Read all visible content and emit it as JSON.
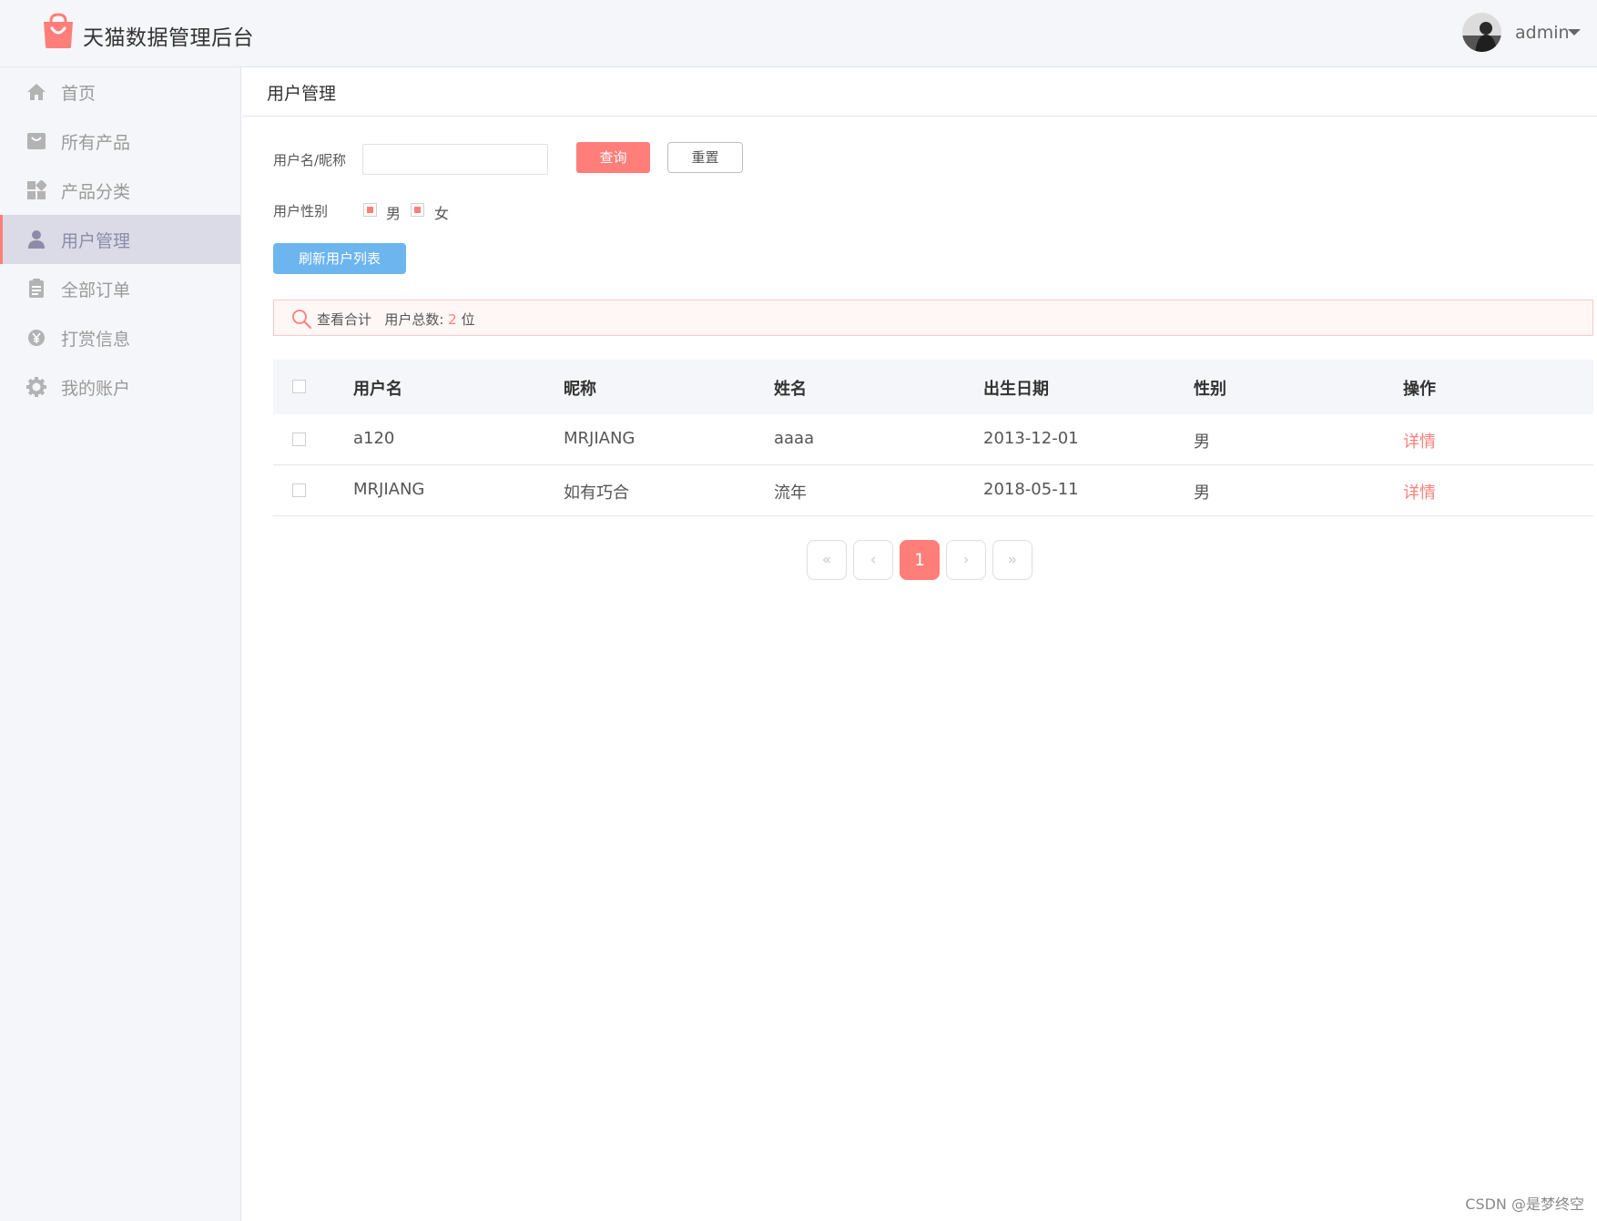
{
  "header": {
    "app_title": "天猫数据管理后台",
    "username": "admin",
    "logo_icon": "shopping-bag-icon",
    "avatar_icon": "user-avatar"
  },
  "sidebar": {
    "items": [
      {
        "label": "首页",
        "icon": "home-icon"
      },
      {
        "label": "所有产品",
        "icon": "product-icon"
      },
      {
        "label": "产品分类",
        "icon": "category-icon"
      },
      {
        "label": "用户管理",
        "icon": "user-icon",
        "active": true
      },
      {
        "label": "全部订单",
        "icon": "order-icon"
      },
      {
        "label": "打赏信息",
        "icon": "yen-coin-icon"
      },
      {
        "label": "我的账户",
        "icon": "gear-icon"
      }
    ]
  },
  "page": {
    "title": "用户管理",
    "filters": {
      "name_label": "用户名/昵称",
      "name_value": "",
      "name_placeholder": "",
      "query_button": "查询",
      "reset_button": "重置",
      "gender_label": "用户性别",
      "gender_options": [
        "男",
        "女"
      ]
    },
    "refresh_button": "刷新用户列表",
    "summary": {
      "prefix": "查看合计",
      "count_label": "用户总数:",
      "count": "2",
      "unit": "位"
    },
    "table": {
      "columns": [
        "用户名",
        "昵称",
        "姓名",
        "出生日期",
        "性别",
        "操作"
      ],
      "rows": [
        {
          "username": "a120",
          "nickname": "MRJIANG",
          "name": "aaaa",
          "birthday": "2013-12-01",
          "gender": "男",
          "action": "详情"
        },
        {
          "username": "MRJIANG",
          "nickname": "如有巧合",
          "name": "流年",
          "birthday": "2018-05-11",
          "gender": "男",
          "action": "详情"
        }
      ]
    },
    "pagination": {
      "first": "«",
      "prev": "‹",
      "current": "1",
      "next": "›",
      "last": "»"
    }
  },
  "watermark": "CSDN @是梦终空",
  "colors": {
    "accent": "#ff7e79",
    "refresh_button": "#6cb5ef",
    "sidebar_bg": "#f5f6fa",
    "sidebar_active_bg": "#dadbe7"
  }
}
